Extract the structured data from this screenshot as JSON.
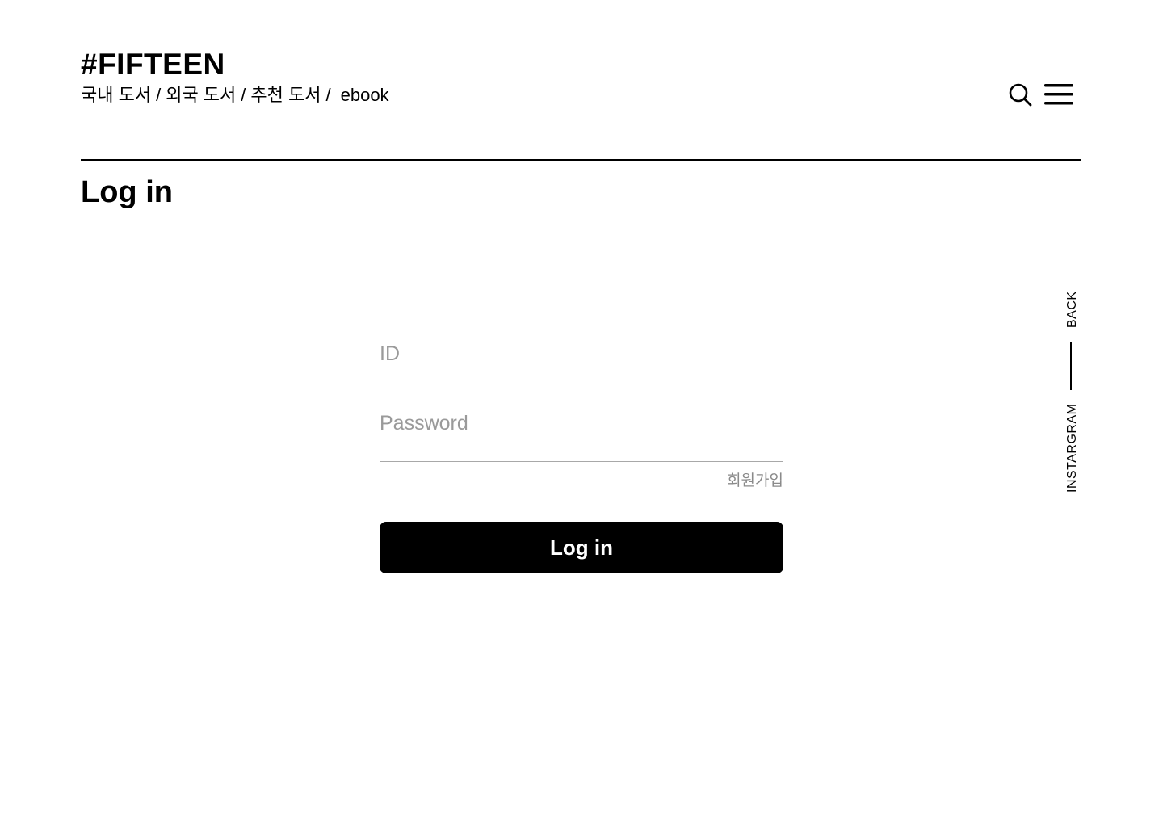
{
  "header": {
    "logo": "#FIFTEEN",
    "nav": {
      "domestic": "국내 도서",
      "foreign": "외국 도서",
      "recommended": "추천 도서",
      "ebook": "ebook",
      "separator": "/"
    },
    "search_icon": "search-icon",
    "menu_icon": "hamburger-menu-icon"
  },
  "page": {
    "title": "Log in"
  },
  "form": {
    "id_placeholder": "ID",
    "password_placeholder": "Password",
    "signup_label": "회원가입",
    "submit_label": "Log in"
  },
  "side": {
    "back_label": "BACK",
    "instagram_label": "INSTARGRAM"
  },
  "colors": {
    "accent": "#000000",
    "background": "#ffffff",
    "placeholder": "#9a9a9a",
    "muted_link": "#8a8a8a"
  }
}
